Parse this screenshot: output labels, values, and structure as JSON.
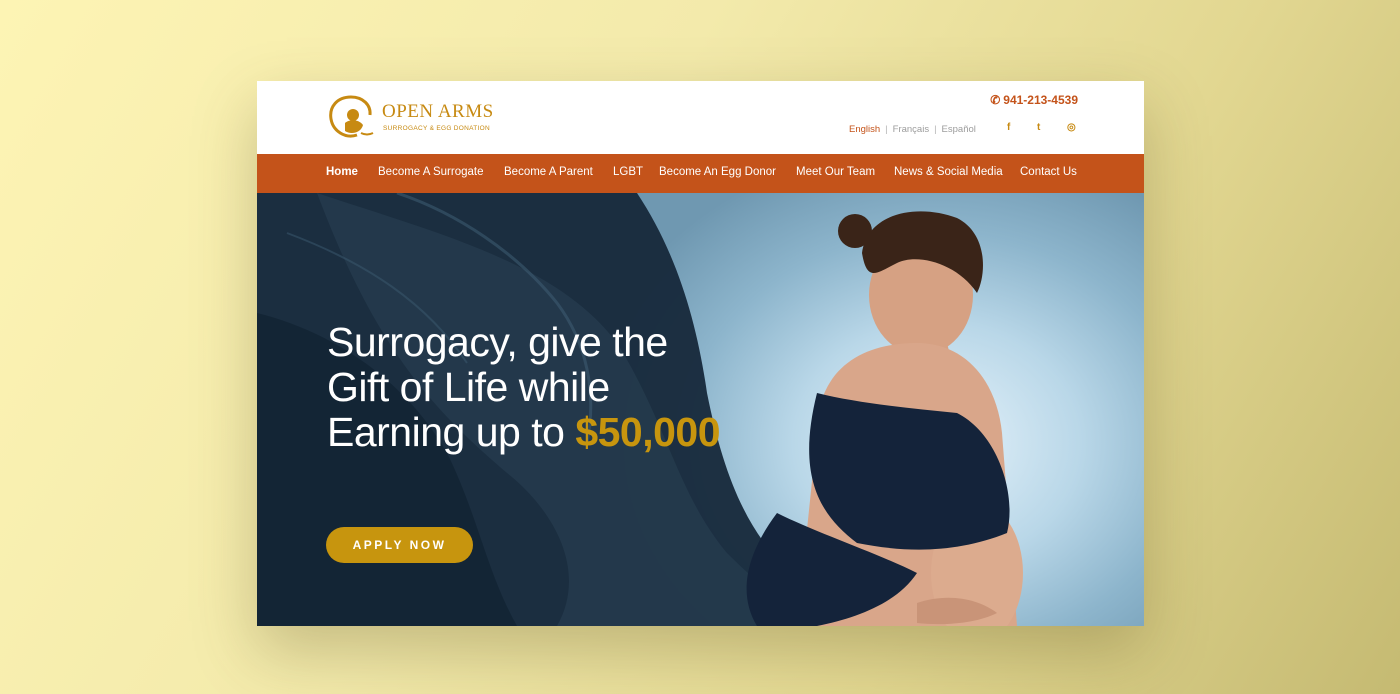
{
  "header": {
    "logo": {
      "name": "OPEN ARMS",
      "tagline": "SURROGACY & EGG DONATION"
    },
    "phone": "941-213-4539",
    "languages": [
      {
        "label": "English",
        "active": true
      },
      {
        "label": "Français",
        "active": false
      },
      {
        "label": "Español",
        "active": false
      }
    ],
    "social": [
      {
        "icon": "facebook-icon",
        "glyph": "f"
      },
      {
        "icon": "twitter-icon",
        "glyph": "t"
      },
      {
        "icon": "instagram-icon",
        "glyph": "◎"
      }
    ]
  },
  "nav": {
    "items": [
      {
        "label": "Home",
        "active": true
      },
      {
        "label": "Become A Surrogate"
      },
      {
        "label": "Become A Parent"
      },
      {
        "label": "LGBT"
      },
      {
        "label": "Become An Egg Donor"
      },
      {
        "label": "Meet Our Team"
      },
      {
        "label": "News & Social Media"
      },
      {
        "label": "Contact Us"
      }
    ]
  },
  "hero": {
    "headline_text": "Surrogacy, give the Gift of Life while Earning up to",
    "headline_amount": "$50,000",
    "cta_label": "APPLY NOW"
  },
  "colors": {
    "brand_orange": "#c4531a",
    "brand_gold": "#c7950e",
    "background": "#f3eaab"
  }
}
